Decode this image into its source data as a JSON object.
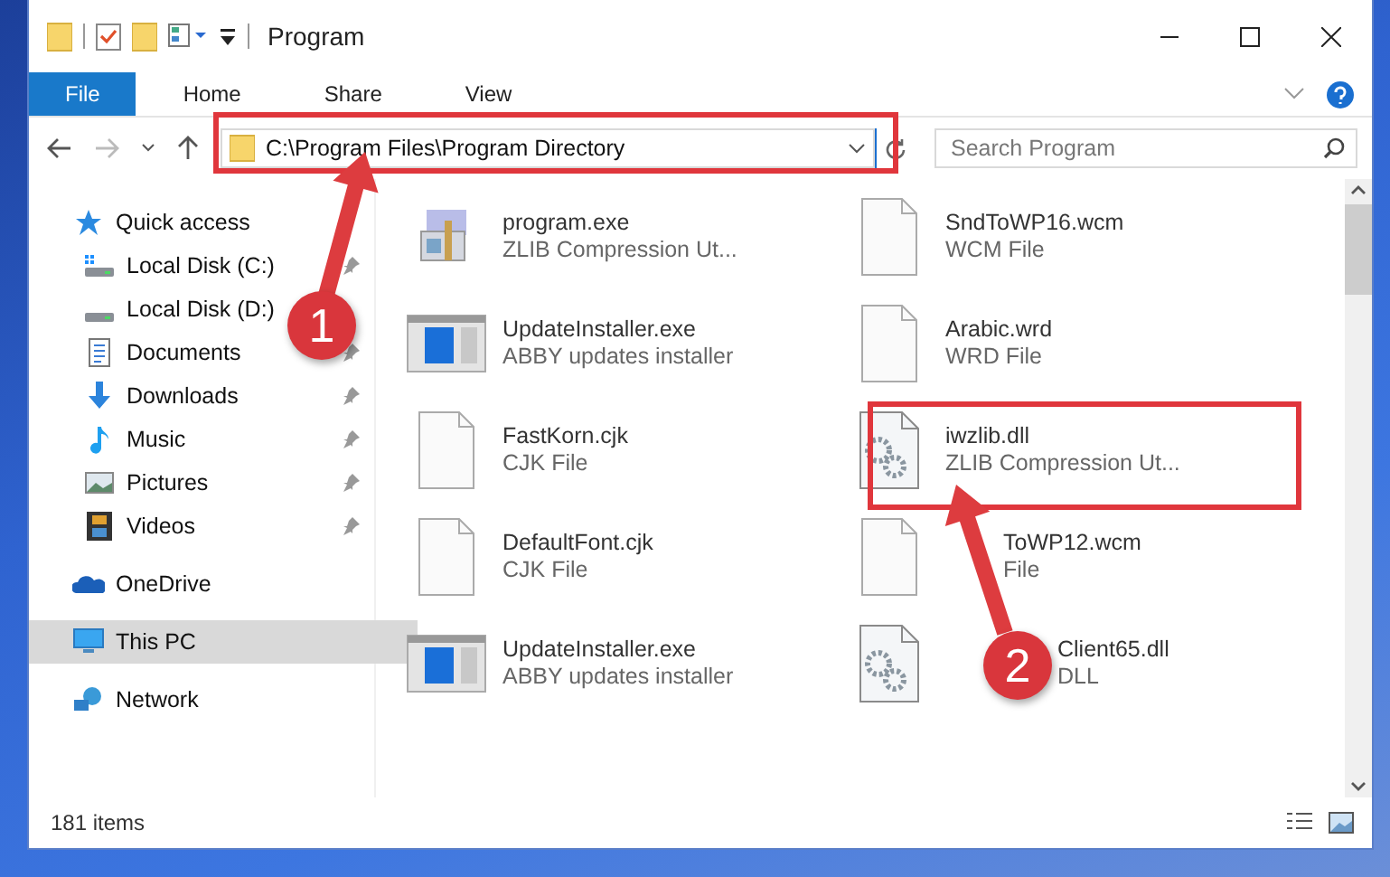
{
  "window": {
    "title": "Program"
  },
  "ribbon_tabs": [
    {
      "label": "File",
      "selected": true
    },
    {
      "label": "Home",
      "selected": false
    },
    {
      "label": "Share",
      "selected": false
    },
    {
      "label": "View",
      "selected": false
    }
  ],
  "address": {
    "path": "C:\\Program Files\\Program Directory"
  },
  "search": {
    "placeholder": "Search Program"
  },
  "sidebar": {
    "items": [
      {
        "label": "Quick access",
        "kind": "star",
        "selected": false,
        "children": [
          {
            "label": "Local Disk (C:)",
            "kind": "drive-c",
            "pinned": true
          },
          {
            "label": "Local Disk (D:)",
            "kind": "drive",
            "pinned": false
          },
          {
            "label": "Documents",
            "kind": "documents",
            "pinned": true
          },
          {
            "label": "Downloads",
            "kind": "downloads",
            "pinned": true
          },
          {
            "label": "Music",
            "kind": "music",
            "pinned": true
          },
          {
            "label": "Pictures",
            "kind": "pictures",
            "pinned": true
          },
          {
            "label": "Videos",
            "kind": "videos",
            "pinned": true
          }
        ]
      },
      {
        "label": "OneDrive",
        "kind": "cloud",
        "selected": false
      },
      {
        "label": "This PC",
        "kind": "pc",
        "selected": true
      },
      {
        "label": "Network",
        "kind": "network",
        "selected": false
      }
    ]
  },
  "files": [
    {
      "name": "program.exe",
      "type": "ZLIB Compression Ut...",
      "kind": "installer"
    },
    {
      "name": "SndToWP16.wcm",
      "type": "WCM File",
      "kind": "blank"
    },
    {
      "name": "UpdateInstaller.exe",
      "type": "ABBY updates installer",
      "kind": "window"
    },
    {
      "name": "Arabic.wrd",
      "type": "WRD File",
      "kind": "blank"
    },
    {
      "name": "FastKorn.cjk",
      "type": "CJK File",
      "kind": "blank"
    },
    {
      "name": "iwzlib.dll",
      "type": "ZLIB Compression Ut...",
      "kind": "gears"
    },
    {
      "name": "DefaultFont.cjk",
      "type": "CJK File",
      "kind": "blank"
    },
    {
      "name": "ToWP12.wcm",
      "type": "File",
      "kind": "blank",
      "covered": true
    },
    {
      "name": "UpdateInstaller.exe",
      "type": "ABBY updates installer",
      "kind": "window"
    },
    {
      "name": "Client65.dll",
      "type": "DLL",
      "kind": "gears",
      "covered": true
    }
  ],
  "status_bar": {
    "text": "181 items"
  },
  "annotations": [
    {
      "label": "1"
    },
    {
      "label": "2"
    }
  ]
}
